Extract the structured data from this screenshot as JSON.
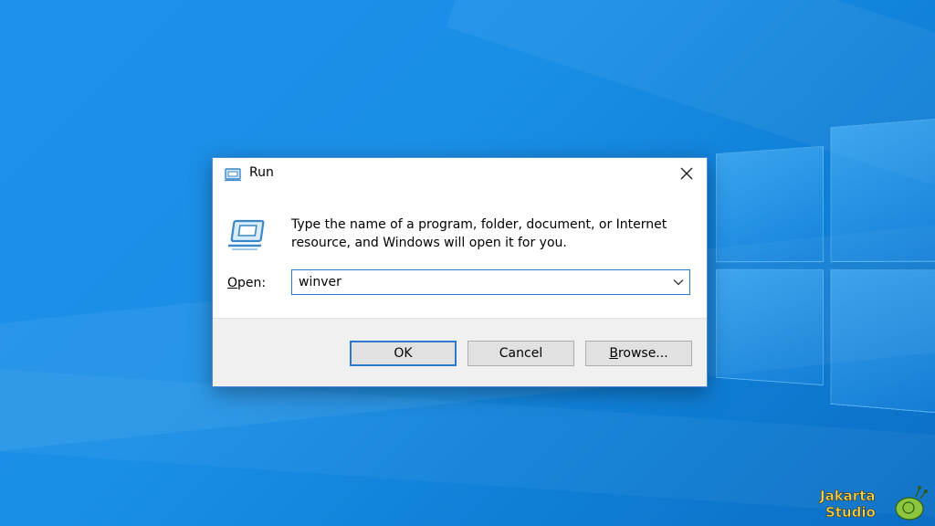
{
  "dialog": {
    "title": "Run",
    "description": "Type the name of a program, folder, document, or Internet resource, and Windows will open it for you.",
    "open_label_accel": "O",
    "open_label_rest": "pen:",
    "open_value": "winver",
    "ok_label": "OK",
    "cancel_label": "Cancel",
    "browse_label_accel": "B",
    "browse_label_rest": "rowse..."
  },
  "icons": {
    "title": "run-icon",
    "close": "close-icon",
    "large": "run-icon",
    "dropdown": "chevron-down-icon"
  },
  "watermark": {
    "line1": "Jakarta",
    "line2": "Studio"
  },
  "colors": {
    "desktop": "#1a8fe6",
    "accent": "#2f78d0",
    "button_face": "#e1e1e1",
    "footer": "#f0f0f0"
  }
}
